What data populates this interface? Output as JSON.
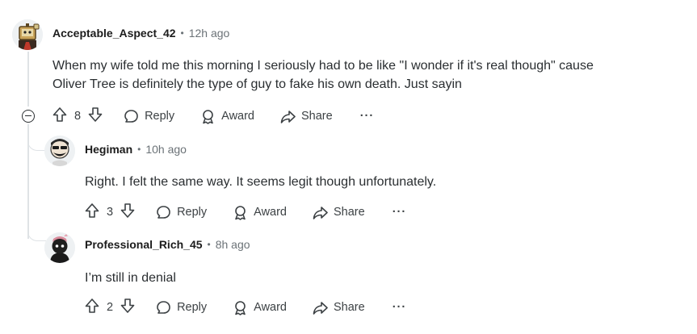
{
  "comments": [
    {
      "author": "Acceptable_Aspect_42",
      "time": "12h ago",
      "text_lines": [
        "When my wife told me this morning I seriously had to be like \"I wonder if it's real though\" cause",
        "Oliver Tree is definitely the type of guy to fake his own death. Just sayin"
      ],
      "votes": "8"
    },
    {
      "author": "Hegiman",
      "time": "10h ago",
      "text_lines": [
        "Right. I felt the same way. It seems legit though unfortunately."
      ],
      "votes": "3"
    },
    {
      "author": "Professional_Rich_45",
      "time": "8h ago",
      "text_lines": [
        "I’m still in denial"
      ],
      "votes": "2"
    }
  ],
  "separator": "•",
  "actions": {
    "reply": "Reply",
    "award": "Award",
    "share": "Share",
    "more": "···"
  },
  "icons": {
    "upvote": "arrow-up-icon",
    "downvote": "arrow-down-icon",
    "reply": "speech-bubble-icon",
    "award": "award-icon",
    "share": "share-arrow-icon",
    "more": "ellipsis-icon",
    "collapse": "collapse-minus-icon"
  }
}
